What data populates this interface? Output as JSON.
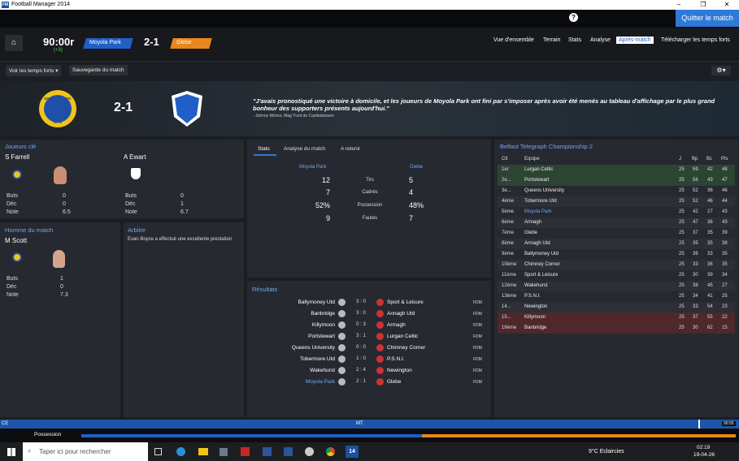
{
  "window": {
    "title": "Football Manager 2014"
  },
  "topbar": {
    "help": "?",
    "quit": "Quitter le match"
  },
  "header": {
    "clock": "90:00r",
    "added": "(+3)",
    "home": "Moyola Park",
    "score": "2-1",
    "away": "Glebe",
    "nav": [
      "Vue d'ensemble",
      "Terrain",
      "Stats",
      "Analyse",
      "Après-match",
      "Télécharger les temps forts"
    ],
    "active_nav": "Après-match"
  },
  "subbar": {
    "highlights": "Voir les temps forts ▾",
    "save": "Sauvegarde du match"
  },
  "banner": {
    "score": "2-1",
    "quote": "\"J'avais pronostiqué une victoire à domicile, et les joueurs de Moyola Park ont fini par s'imposer après avoir été menés au tableau d'affichage par le plus grand bonheur des supporters présents aujourd'hui.\"",
    "quote_by": "- Johnny McIvor, Mag' Foot de Castledawson",
    "home_crest_text": "MOYOLA PARK",
    "home_crest_sub": "AFC"
  },
  "key_players": {
    "title": "Joueurs clé",
    "home": {
      "name": "S Farrell",
      "buts": "0",
      "dec": "0",
      "note": "6.5"
    },
    "away": {
      "name": "A Ewart",
      "buts": "0",
      "dec": "1",
      "note": "6.7"
    },
    "labels": {
      "buts": "Buts",
      "dec": "Déc",
      "note": "Note"
    }
  },
  "motm": {
    "title": "Homme du match",
    "name": "M Scott",
    "buts": "1",
    "dec": "0",
    "note": "7.3"
  },
  "referee": {
    "title": "Arbitre",
    "text": "Evan Boyce a effectué une excellente prestation"
  },
  "stats": {
    "tabs": [
      "Stats",
      "Analyse du match",
      "A retenir"
    ],
    "home": "Moyola Park",
    "away": "Glebe",
    "rows": [
      {
        "h": "12",
        "label": "Tirs",
        "a": "5"
      },
      {
        "h": "7",
        "label": "Cadrés",
        "a": "4"
      },
      {
        "h": "52%",
        "label": "Possession",
        "a": "48%"
      },
      {
        "h": "9",
        "label": "Fautes",
        "a": "7"
      }
    ]
  },
  "results": {
    "title": "Résultats",
    "rows": [
      {
        "h": "Ballymoney Utd",
        "s": "3 : 0",
        "a": "Sport & Leisure",
        "c": "FDM"
      },
      {
        "h": "Banbridge",
        "s": "3 : 0",
        "a": "Annagh Utd",
        "c": "FDM"
      },
      {
        "h": "Killymoon",
        "s": "0 : 3",
        "a": "Armagh",
        "c": "FDM"
      },
      {
        "h": "Portstewart",
        "s": "3 : 1",
        "a": "Lurgan Celtic",
        "c": "FDM"
      },
      {
        "h": "Queens University",
        "s": "0 : 0",
        "a": "Chimney Corner",
        "c": "FDM"
      },
      {
        "h": "Tobermore Utd",
        "s": "1 : 0",
        "a": "P.S.N.I.",
        "c": "FDM"
      },
      {
        "h": "Wakehurst",
        "s": "2 : 4",
        "a": "Newington",
        "c": "FDM"
      },
      {
        "h": "Moyola Park",
        "s": "2 : 1",
        "a": "Glebe",
        "c": "FDM"
      }
    ]
  },
  "league": {
    "title": "Belfast Telegraph Championship 2",
    "headers": [
      "Clt",
      "Equipe",
      "J",
      "Bp",
      "Bc",
      "Pts"
    ],
    "rows": [
      {
        "p": "1er",
        "t": "Lurgan Celtic",
        "j": "25",
        "bp": "59",
        "bc": "42",
        "pts": "48"
      },
      {
        "p": "2e...",
        "t": "Portstewart",
        "j": "25",
        "bp": "56",
        "bc": "43",
        "pts": "47"
      },
      {
        "p": "3e...",
        "t": "Queens University",
        "j": "25",
        "bp": "52",
        "bc": "36",
        "pts": "46"
      },
      {
        "p": "4ème",
        "t": "Tobermore Utd",
        "j": "25",
        "bp": "52",
        "bc": "46",
        "pts": "44"
      },
      {
        "p": "5ème",
        "t": "Moyola Park",
        "j": "25",
        "bp": "42",
        "bc": "27",
        "pts": "43"
      },
      {
        "p": "6ème",
        "t": "Armagh",
        "j": "25",
        "bp": "47",
        "bc": "36",
        "pts": "43"
      },
      {
        "p": "7ème",
        "t": "Glebe",
        "j": "25",
        "bp": "37",
        "bc": "35",
        "pts": "39"
      },
      {
        "p": "8ème",
        "t": "Annagh Utd",
        "j": "25",
        "bp": "35",
        "bc": "35",
        "pts": "38"
      },
      {
        "p": "9ème",
        "t": "Ballymoney Utd",
        "j": "25",
        "bp": "36",
        "bc": "33",
        "pts": "35"
      },
      {
        "p": "10ème",
        "t": "Chimney Corner",
        "j": "25",
        "bp": "33",
        "bc": "36",
        "pts": "35"
      },
      {
        "p": "11ème",
        "t": "Sport & Leisure",
        "j": "25",
        "bp": "30",
        "bc": "39",
        "pts": "34"
      },
      {
        "p": "12ème",
        "t": "Wakehurst",
        "j": "25",
        "bp": "38",
        "bc": "45",
        "pts": "27"
      },
      {
        "p": "13ème",
        "t": "P.S.N.I.",
        "j": "25",
        "bp": "34",
        "bc": "41",
        "pts": "25"
      },
      {
        "p": "14...",
        "t": "Newington",
        "j": "25",
        "bp": "33",
        "bc": "54",
        "pts": "23"
      },
      {
        "p": "15...",
        "t": "Killymoon",
        "j": "25",
        "bp": "37",
        "bc": "55",
        "pts": "22"
      },
      {
        "p": "16ème",
        "t": "Banbridge",
        "j": "25",
        "bp": "30",
        "bc": "62",
        "pts": "15"
      }
    ]
  },
  "statusbar": {
    "left": "CE",
    "mid": "MT",
    "time": "90:55"
  },
  "possession": {
    "label": "Possession",
    "home_pct": 52
  },
  "taskbar": {
    "search": "Taper ici pour rechercher",
    "weather": "9°C  Eclaircies",
    "time": "02:19",
    "date": "19-04-26"
  },
  "colors": {
    "accent": "#2f7ad9",
    "home": "#1f5fc7",
    "away": "#e8861b"
  }
}
